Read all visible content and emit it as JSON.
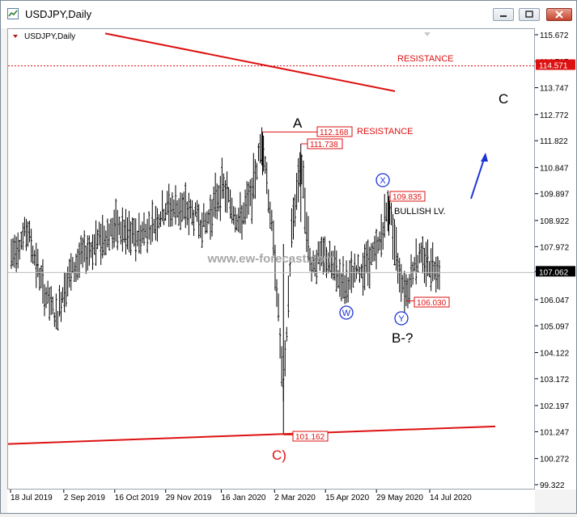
{
  "window": {
    "title": "USDJPY,Daily",
    "chart_label": "USDJPY,Daily",
    "watermark": "www.ew-forecast.com",
    "controls": [
      "minimize",
      "maximize",
      "close"
    ]
  },
  "colors": {
    "bars": "#000000",
    "resistance": "#dd1111",
    "support": "#dd1111",
    "wave_blue": "#1a33d9",
    "watermark": "#a8a8a8",
    "price_marker_bg": "#000000"
  },
  "chart_data": {
    "type": "ohlc",
    "symbol": "USDJPY",
    "timeframe": "Daily",
    "ylim": [
      99.322,
      115.672
    ],
    "y_ticks": [
      "115.672",
      "114.707",
      "113.747",
      "112.772",
      "111.822",
      "110.847",
      "109.897",
      "108.922",
      "107.972",
      "107.062",
      "106.047",
      "105.097",
      "104.122",
      "103.172",
      "102.197",
      "101.247",
      "100.272",
      "99.322"
    ],
    "x_ticks": [
      "18 Jul 2019",
      "2 Sep 2019",
      "16 Oct 2019",
      "29 Nov 2019",
      "16 Jan 2020",
      "2 Mar 2020",
      "15 Apr 2020",
      "29 May 2020",
      "14 Jul 2020"
    ],
    "current_price": "107.062",
    "resistance_level": "114.571",
    "labels": [
      {
        "text": "RESISTANCE",
        "price": 114.571
      },
      {
        "text": "RESISTANCE",
        "price": 112.168
      }
    ],
    "price_labels": [
      {
        "value": "112.168",
        "date": "20 Feb 2020"
      },
      {
        "value": "111.738",
        "date": "24 Mar 2020"
      },
      {
        "value": "109.835",
        "date": "8 Jun 2020"
      },
      {
        "value": "106.030",
        "date": "23 Jun 2020"
      },
      {
        "value": "101.162",
        "date": "9 Mar 2020"
      }
    ],
    "wave_labels": {
      "A": "A",
      "B": "B-?",
      "C": "C",
      "C_prev": "C)",
      "W": "W",
      "X": "X",
      "Y": "Y"
    },
    "annotation": "BULLISH LV.",
    "series": [
      {
        "dates": [
          "18 Jul 2019",
          "1 Aug 2019",
          "15 Aug 2019",
          "26 Aug 2019",
          "2 Sep 2019",
          "16 Sep 2019",
          "1 Oct 2019",
          "16 Oct 2019",
          "1 Nov 2019",
          "15 Nov 2019",
          "29 Nov 2019",
          "13 Dec 2019",
          "2 Jan 2020",
          "16 Jan 2020",
          "31 Jan 2020",
          "10 Feb 2020",
          "20 Feb 2020",
          "2 Mar 2020",
          "9 Mar 2020",
          "16 Mar 2020",
          "24 Mar 2020",
          "1 Apr 2020",
          "15 Apr 2020",
          "23 Apr 2020",
          "1 May 2020",
          "15 May 2020",
          "29 May 2020",
          "8 Jun 2020",
          "16 Jun 2020",
          "23 Jun 2020",
          "1 Jul 2020",
          "14 Jul 2020",
          "22 Jul 2020"
        ],
        "values": [
          107.7,
          108.6,
          106.4,
          105.4,
          106.6,
          107.6,
          108.2,
          108.7,
          108.3,
          108.7,
          109.4,
          109.4,
          108.8,
          110.2,
          108.9,
          109.8,
          112.0,
          107.4,
          102.5,
          108.5,
          111.2,
          107.4,
          107.6,
          107.1,
          106.6,
          107.2,
          107.8,
          109.6,
          107.3,
          106.3,
          107.6,
          107.4,
          107.2
        ]
      }
    ]
  }
}
